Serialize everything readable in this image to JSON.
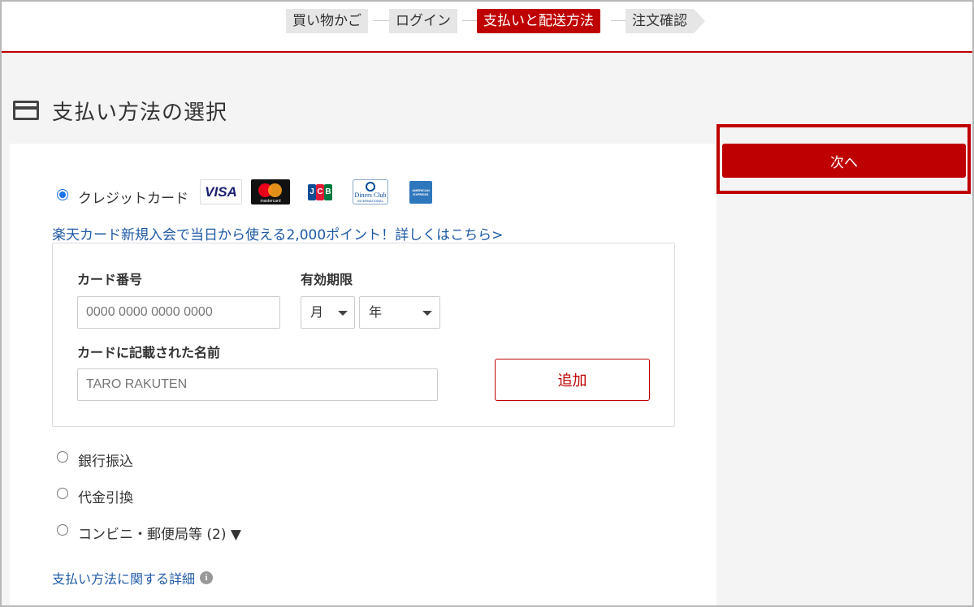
{
  "steps": [
    "買い物かご",
    "ログイン",
    "支払いと配送方法",
    "注文確認"
  ],
  "section_title": "支払い方法の選択",
  "payment_options": {
    "credit_card": "クレジットカード",
    "bank_transfer": "銀行振込",
    "cod": "代金引換",
    "convenience": "コンビニ・郵便局等 (2) ▼"
  },
  "card_brands": {
    "visa": "VISA",
    "mastercard": "mastercard",
    "jcb": [
      "J",
      "C",
      "B"
    ],
    "diners": "Diners Club",
    "diners_sub": "INTERNATIONAL",
    "amex": "AMERICAN EXPRESS"
  },
  "promo_link": "楽天カード新規入会で当日から使える2,000ポイント！詳しくはこちら>",
  "card_form": {
    "number_label": "カード番号",
    "number_placeholder": "0000 0000 0000 0000",
    "expiry_label": "有効期限",
    "month_value": "月",
    "year_value": "年",
    "name_label": "カードに記載された名前",
    "name_placeholder": "TARO RAKUTEN",
    "add_button": "追加"
  },
  "detail_link": "支払い方法に関する詳細",
  "info_glyph": "i",
  "next_button": "次へ",
  "colors": {
    "brand_red": "#bf0000",
    "link_blue": "#1f5aa6",
    "radio_blue": "#1a73e8",
    "jcb_blue": "#0e4c96",
    "jcb_red": "#e21836",
    "jcb_green": "#007940"
  },
  "icons": {
    "section": "credit-card-icon",
    "detail": "info-icon"
  }
}
